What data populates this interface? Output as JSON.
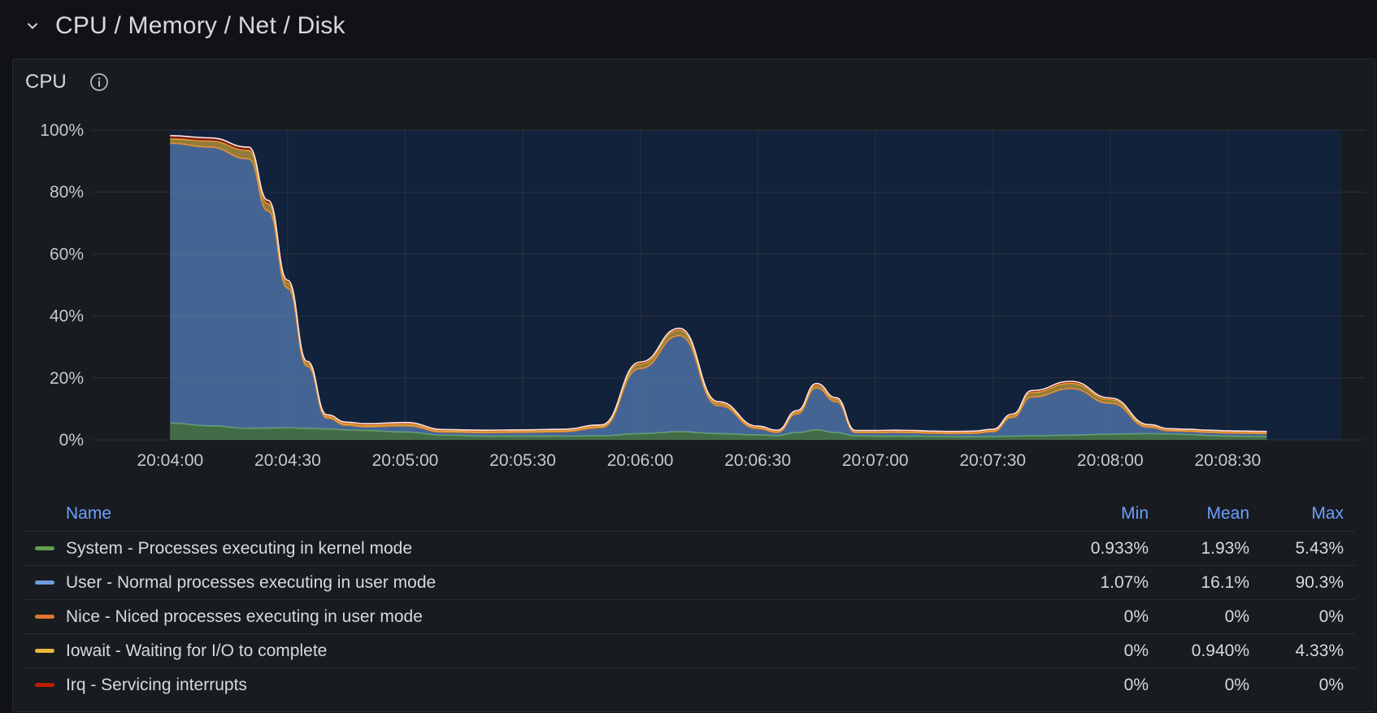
{
  "row": {
    "title": "CPU / Memory / Net / Disk",
    "chevron_icon": "chevron-down-icon"
  },
  "panel": {
    "title": "CPU",
    "info_icon": "info-circle-icon"
  },
  "colors": {
    "system": "#629e51",
    "user": "#6d9ddd",
    "nice": "#e0752d",
    "iowait": "#eab839",
    "irq": "#bf1b00",
    "total_line": "#ffffff",
    "plot_bg": "#12223b"
  },
  "legend": {
    "headers": {
      "name": "Name",
      "min": "Min",
      "mean": "Mean",
      "max": "Max"
    },
    "rows": [
      {
        "name": "System - Processes executing in kernel mode",
        "color": "#629e51",
        "min": "0.933%",
        "mean": "1.93%",
        "max": "5.43%"
      },
      {
        "name": "User - Normal processes executing in user mode",
        "color": "#6d9ddd",
        "min": "1.07%",
        "mean": "16.1%",
        "max": "90.3%"
      },
      {
        "name": "Nice - Niced processes executing in user mode",
        "color": "#e0752d",
        "min": "0%",
        "mean": "0%",
        "max": "0%"
      },
      {
        "name": "Iowait - Waiting for I/O to complete",
        "color": "#eab839",
        "min": "0%",
        "mean": "0.940%",
        "max": "4.33%"
      },
      {
        "name": "Irq - Servicing interrupts",
        "color": "#bf1b00",
        "min": "0%",
        "mean": "0%",
        "max": "0%"
      }
    ]
  },
  "chart_data": {
    "type": "area",
    "stacked": true,
    "title": "CPU",
    "x_ticks": [
      "20:04:00",
      "20:04:30",
      "20:05:00",
      "20:05:30",
      "20:06:00",
      "20:06:30",
      "20:07:00",
      "20:07:30",
      "20:08:00",
      "20:08:30"
    ],
    "y_ticks": [
      "0%",
      "20%",
      "40%",
      "60%",
      "80%",
      "100%"
    ],
    "ylim": [
      0,
      100
    ],
    "xlim_seconds": [
      -20,
      305
    ],
    "x": [
      0,
      10,
      20,
      25,
      30,
      35,
      40,
      45,
      50,
      60,
      70,
      80,
      90,
      100,
      110,
      120,
      130,
      140,
      150,
      155,
      160,
      165,
      170,
      175,
      180,
      185,
      190,
      195,
      200,
      205,
      210,
      215,
      220,
      230,
      240,
      250,
      255,
      260,
      265,
      270,
      275,
      280
    ],
    "series": [
      {
        "name": "System",
        "values": [
          5.4,
          4.5,
          3.7,
          3.8,
          3.9,
          3.7,
          3.5,
          3.2,
          3.0,
          2.5,
          1.5,
          1.2,
          1.2,
          1.2,
          1.3,
          2.0,
          2.6,
          2.0,
          1.6,
          1.4,
          2.3,
          3.2,
          2.3,
          1.3,
          1.2,
          1.2,
          1.2,
          1.1,
          1.0,
          1.0,
          1.1,
          1.2,
          1.3,
          1.5,
          1.8,
          2.0,
          1.9,
          1.7,
          1.4,
          1.2,
          1.1,
          1.0
        ]
      },
      {
        "name": "User",
        "values": [
          90.3,
          90.0,
          87.0,
          70.0,
          45.0,
          20.0,
          3.5,
          1.5,
          1.2,
          2.0,
          1.0,
          1.1,
          1.2,
          1.4,
          2.6,
          21.0,
          31.0,
          9.0,
          2.0,
          1.0,
          6.0,
          13.5,
          10.0,
          1.0,
          1.1,
          1.2,
          1.1,
          1.0,
          1.0,
          1.1,
          1.5,
          6.0,
          12.5,
          15.0,
          10.0,
          2.0,
          1.0,
          1.0,
          1.0,
          1.0,
          1.0,
          1.0
        ]
      },
      {
        "name": "Nice",
        "values": [
          0,
          0,
          0,
          0,
          0,
          0,
          0,
          0,
          0,
          0,
          0,
          0,
          0,
          0,
          0,
          0,
          0,
          0,
          0,
          0,
          0,
          0,
          0,
          0,
          0,
          0,
          0,
          0,
          0,
          0,
          0,
          0,
          0,
          0,
          0,
          0,
          0,
          0,
          0,
          0,
          0,
          0
        ]
      },
      {
        "name": "Iowait",
        "values": [
          1.5,
          2.0,
          2.8,
          2.5,
          1.8,
          1.0,
          0.6,
          0.5,
          0.5,
          0.6,
          0.4,
          0.4,
          0.4,
          0.4,
          0.5,
          1.5,
          1.8,
          0.8,
          0.4,
          0.3,
          0.6,
          0.9,
          0.8,
          0.3,
          0.3,
          0.3,
          0.3,
          0.3,
          0.3,
          0.3,
          0.4,
          0.6,
          1.5,
          1.8,
          1.2,
          0.5,
          0.3,
          0.3,
          0.3,
          0.3,
          0.3,
          0.3
        ]
      },
      {
        "name": "Irq",
        "values": [
          1.0,
          1.0,
          1.0,
          1.0,
          0.8,
          0.6,
          0.5,
          0.5,
          0.5,
          0.5,
          0.4,
          0.4,
          0.4,
          0.4,
          0.4,
          0.6,
          0.6,
          0.5,
          0.4,
          0.4,
          0.5,
          0.6,
          0.5,
          0.4,
          0.4,
          0.4,
          0.4,
          0.4,
          0.4,
          0.4,
          0.4,
          0.5,
          0.6,
          0.6,
          0.5,
          0.4,
          0.4,
          0.4,
          0.4,
          0.4,
          0.4,
          0.4
        ]
      }
    ]
  }
}
